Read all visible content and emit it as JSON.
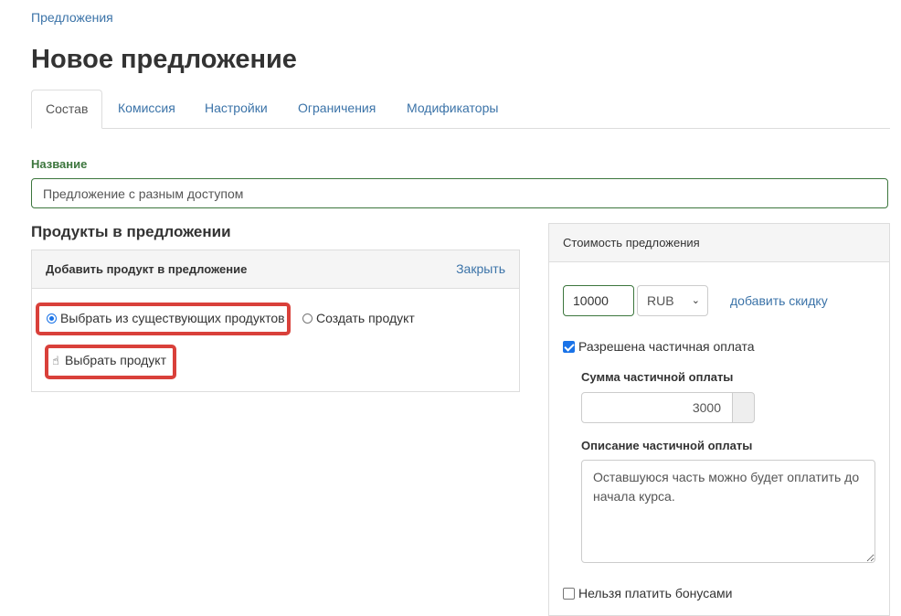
{
  "breadcrumb": "Предложения",
  "page_title": "Новое предложение",
  "tabs": [
    {
      "label": "Состав",
      "active": true
    },
    {
      "label": "Комиссия",
      "active": false
    },
    {
      "label": "Настройки",
      "active": false
    },
    {
      "label": "Ограничения",
      "active": false
    },
    {
      "label": "Модификаторы",
      "active": false
    }
  ],
  "name_field": {
    "label": "Название",
    "value": "Предложение с разным доступом"
  },
  "products": {
    "title": "Продукты в предложении",
    "add_panel": {
      "title": "Добавить продукт в предложение",
      "close_label": "Закрыть",
      "option_existing": "Выбрать из существующих продуктов",
      "option_create": "Создать продукт",
      "selected_option": "existing",
      "choose_button": "Выбрать продукт",
      "choose_icon": "hand-pointer-icon"
    }
  },
  "pricing": {
    "title": "Стоимость предложения",
    "price": "10000",
    "currency": "RUB",
    "add_discount": "добавить скидку",
    "partial_allowed_label": "Разрешена частичная оплата",
    "partial_allowed": true,
    "partial_sum_label": "Сумма частичной оплаты",
    "partial_sum": "3000",
    "partial_desc_label": "Описание частичной оплаты",
    "partial_desc": "Оставшуюся часть можно будет оплатить до начала курса.",
    "no_bonus_label": "Нельзя платить бонусами",
    "no_bonus": false
  },
  "colors": {
    "link": "#3b73a8",
    "success": "#3c763d",
    "highlight": "#d9403a",
    "accent": "#1a73e8"
  }
}
